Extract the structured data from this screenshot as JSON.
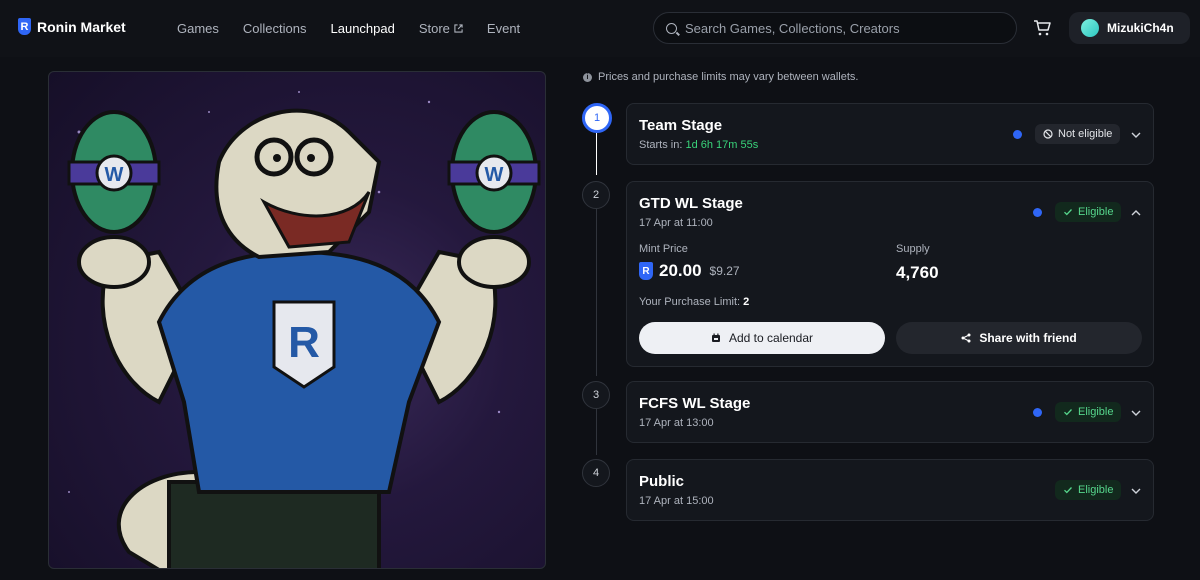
{
  "nav": {
    "brand": "Ronin Market",
    "brand_mark": "R",
    "links": [
      {
        "label": "Games",
        "active": false
      },
      {
        "label": "Collections",
        "active": false
      },
      {
        "label": "Launchpad",
        "active": true
      },
      {
        "label": "Store",
        "active": false,
        "external": true
      },
      {
        "label": "Event",
        "active": false
      }
    ],
    "search_placeholder": "Search Games, Collections, Creators",
    "username": "MizukiCh4n"
  },
  "disclaimer": "Prices and purchase limits may vary between wallets.",
  "stages": [
    {
      "number": "1",
      "title": "Team Stage",
      "sub_prefix": "Starts in:",
      "countdown": "1d 6h 17m 55s",
      "status": "Not eligible",
      "eligible": false,
      "expanded": false,
      "active": true
    },
    {
      "number": "2",
      "title": "GTD WL Stage",
      "sub": "17 Apr at 11:00",
      "status": "Eligible",
      "eligible": true,
      "expanded": true,
      "mint_price_label": "Mint Price",
      "mint_price": "20.00",
      "mint_price_usd": "$9.27",
      "currency_mark": "R",
      "supply_label": "Supply",
      "supply": "4,760",
      "limit_label": "Your Purchase Limit:",
      "limit": "2",
      "calendar_button": "Add to calendar",
      "share_button": "Share with friend"
    },
    {
      "number": "3",
      "title": "FCFS WL Stage",
      "sub": "17 Apr at 13:00",
      "status": "Eligible",
      "eligible": true,
      "expanded": false
    },
    {
      "number": "4",
      "title": "Public",
      "sub": "17 Apr at 15:00",
      "status": "Eligible",
      "eligible": true,
      "expanded": false
    }
  ],
  "art": {
    "shirt_letter": "R",
    "egg_letter": "W"
  },
  "colors": {
    "accent": "#2f66f6",
    "eligible": "#56d68c",
    "countdown": "#39d37a",
    "bg": "#0e1015"
  }
}
